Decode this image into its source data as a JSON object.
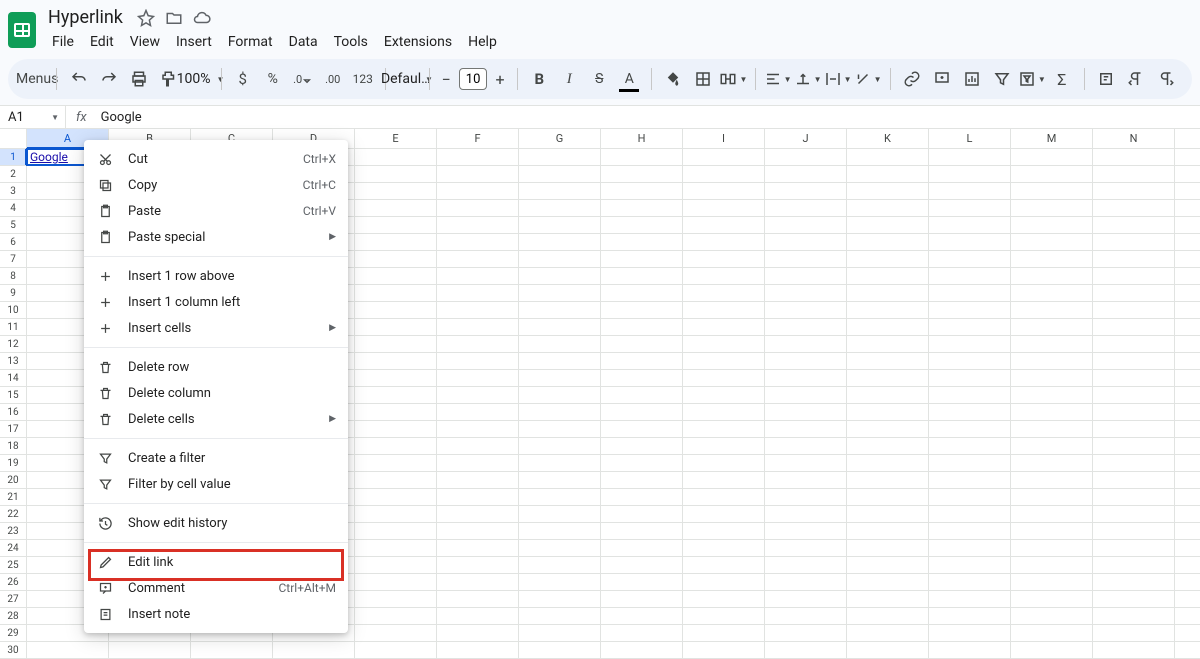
{
  "doc": {
    "title": "Hyperlink"
  },
  "menus": [
    "File",
    "Edit",
    "View",
    "Insert",
    "Format",
    "Data",
    "Tools",
    "Extensions",
    "Help"
  ],
  "toolbar": {
    "menus_label": "Menus",
    "zoom": "100%",
    "font_name": "Defaul…",
    "font_size": "10",
    "number_format_label": "123"
  },
  "namebox": {
    "ref": "A1"
  },
  "formula": {
    "value": "Google"
  },
  "columns": [
    "A",
    "B",
    "C",
    "D",
    "E",
    "F",
    "G",
    "H",
    "I",
    "J",
    "K",
    "L",
    "M",
    "N"
  ],
  "rows": 30,
  "active_cell": {
    "value": "Google"
  },
  "context_menu": {
    "groups": [
      [
        {
          "id": "cut",
          "icon": "cut",
          "label": "Cut",
          "shortcut": "Ctrl+X"
        },
        {
          "id": "copy",
          "icon": "copy",
          "label": "Copy",
          "shortcut": "Ctrl+C"
        },
        {
          "id": "paste",
          "icon": "paste",
          "label": "Paste",
          "shortcut": "Ctrl+V"
        },
        {
          "id": "paste-special",
          "icon": "paste",
          "label": "Paste special",
          "submenu": true
        }
      ],
      [
        {
          "id": "insert-row-above",
          "icon": "plus",
          "label": "Insert 1 row above"
        },
        {
          "id": "insert-col-left",
          "icon": "plus",
          "label": "Insert 1 column left"
        },
        {
          "id": "insert-cells",
          "icon": "plus",
          "label": "Insert cells",
          "submenu": true
        }
      ],
      [
        {
          "id": "delete-row",
          "icon": "trash",
          "label": "Delete row"
        },
        {
          "id": "delete-column",
          "icon": "trash",
          "label": "Delete column"
        },
        {
          "id": "delete-cells",
          "icon": "trash",
          "label": "Delete cells",
          "submenu": true
        }
      ],
      [
        {
          "id": "create-filter",
          "icon": "filter",
          "label": "Create a filter"
        },
        {
          "id": "filter-by-value",
          "icon": "filter",
          "label": "Filter by cell value"
        }
      ],
      [
        {
          "id": "show-edit-history",
          "icon": "history",
          "label": "Show edit history"
        }
      ],
      [
        {
          "id": "edit-link",
          "icon": "pencil",
          "label": "Edit link"
        },
        {
          "id": "comment",
          "icon": "comment",
          "label": "Comment",
          "shortcut": "Ctrl+Alt+M"
        },
        {
          "id": "insert-note",
          "icon": "note",
          "label": "Insert note"
        }
      ]
    ]
  }
}
